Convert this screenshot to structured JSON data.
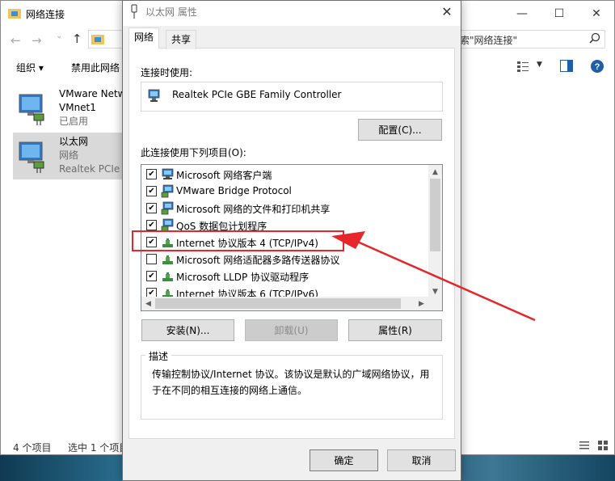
{
  "explorer": {
    "title": "网络连接",
    "search_text": "索\"网络连接\"",
    "toolbar": {
      "organize": "组织 ▾",
      "disable": "禁用此网络"
    },
    "items": [
      {
        "name": "VMware Netw",
        "line2": "VMnet1",
        "line3": "已启用",
        "selected": false
      },
      {
        "name": "以太网",
        "line2": "网络",
        "line3": "Realtek PCIe",
        "selected": true
      }
    ],
    "status_count": "4 个项目",
    "status_selected": "选中 1 个项目"
  },
  "dialog": {
    "title": "以太网 属性",
    "tabs": [
      {
        "label": "网络",
        "active": true
      },
      {
        "label": "共享",
        "active": false
      }
    ],
    "connect_using_label": "连接时使用:",
    "adapter_name": "Realtek PCIe GBE Family Controller",
    "configure_button": "配置(C)...",
    "items_label": "此连接使用下列项目(O):",
    "items": [
      {
        "label": "Microsoft 网络客户端",
        "checked": true,
        "icon": "network-client-icon"
      },
      {
        "label": "VMware Bridge Protocol",
        "checked": true,
        "icon": "network-service-icon"
      },
      {
        "label": "Microsoft 网络的文件和打印机共享",
        "checked": true,
        "icon": "network-service-icon"
      },
      {
        "label": "QoS 数据包计划程序",
        "checked": true,
        "icon": "network-service-icon"
      },
      {
        "label": "Internet 协议版本 4 (TCP/IPv4)",
        "checked": true,
        "icon": "protocol-icon"
      },
      {
        "label": "Microsoft 网络适配器多路传送器协议",
        "checked": false,
        "icon": "protocol-icon"
      },
      {
        "label": "Microsoft LLDP 协议驱动程序",
        "checked": true,
        "icon": "protocol-icon"
      },
      {
        "label": "Internet 协议版本 6 (TCP/IPv6)",
        "checked": true,
        "icon": "protocol-icon"
      }
    ],
    "install_button": "安装(N)...",
    "uninstall_button": "卸载(U)",
    "properties_button": "属性(R)",
    "description_title": "描述",
    "description_text": "传输控制协议/Internet 协议。该协议是默认的广域网络协议，用于在不同的相互连接的网络上通信。",
    "ok_button": "确定",
    "cancel_button": "取消"
  },
  "annotation": {
    "color": "#e6262b"
  }
}
